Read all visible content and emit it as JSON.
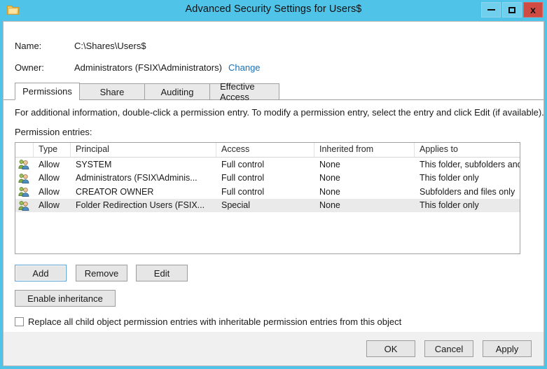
{
  "window": {
    "title": "Advanced Security Settings for Users$",
    "icon": "folder-icon",
    "accent_color": "#4fc3e8",
    "close_color": "#d04b43",
    "controls": {
      "minimize": "–",
      "maximize": "□",
      "close": "x"
    }
  },
  "header": {
    "name_label": "Name:",
    "name_value": "C:\\Shares\\Users$",
    "owner_label": "Owner:",
    "owner_value": "Administrators (FSIX\\Administrators)",
    "change_link": "Change",
    "link_color": "#1570b8"
  },
  "tabs": [
    {
      "label": "Permissions",
      "active": true
    },
    {
      "label": "Share",
      "active": false
    },
    {
      "label": "Auditing",
      "active": false
    },
    {
      "label": "Effective Access",
      "active": false
    }
  ],
  "main": {
    "info_text": "For additional information, double-click a permission entry. To modify a permission entry, select the entry and click Edit (if available).",
    "entries_label": "Permission entries:"
  },
  "table": {
    "columns": [
      "",
      "Type",
      "Principal",
      "Access",
      "Inherited from",
      "Applies to"
    ],
    "rows": [
      {
        "icon": "users-group-icon",
        "type": "Allow",
        "principal": "SYSTEM",
        "access": "Full control",
        "inherited_from": "None",
        "applies_to": "This folder, subfolders and files",
        "selected": false
      },
      {
        "icon": "users-group-icon",
        "type": "Allow",
        "principal": "Administrators (FSIX\\Adminis...",
        "access": "Full control",
        "inherited_from": "None",
        "applies_to": "This folder only",
        "selected": false
      },
      {
        "icon": "users-group-icon",
        "type": "Allow",
        "principal": "CREATOR OWNER",
        "access": "Full control",
        "inherited_from": "None",
        "applies_to": "Subfolders and files only",
        "selected": false
      },
      {
        "icon": "users-group-icon",
        "type": "Allow",
        "principal": "Folder Redirection Users (FSIX...",
        "access": "Special",
        "inherited_from": "None",
        "applies_to": "This folder only",
        "selected": true
      }
    ]
  },
  "actions": {
    "add": "Add",
    "remove": "Remove",
    "edit": "Edit",
    "enable_inheritance": "Enable inheritance"
  },
  "options": {
    "replace_child_label": "Replace all child object permission entries with inheritable permission entries from this object",
    "replace_child_checked": false
  },
  "footer": {
    "ok": "OK",
    "cancel": "Cancel",
    "apply": "Apply"
  }
}
